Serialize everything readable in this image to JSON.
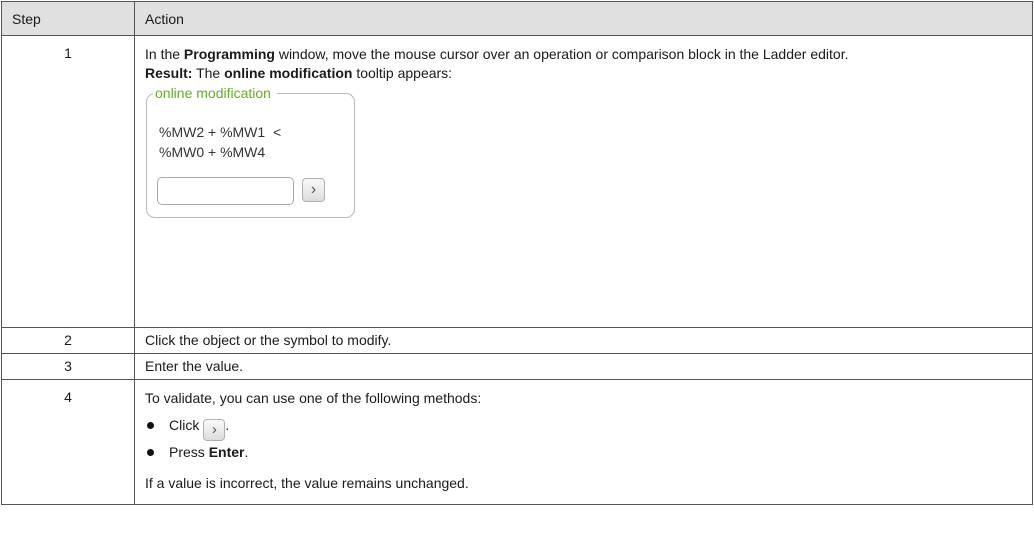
{
  "table": {
    "headers": {
      "step": "Step",
      "action": "Action"
    },
    "row1": {
      "num": "1",
      "text_pre": "In the ",
      "bold1": "Programming",
      "text_post": " window, move the mouse cursor over an operation or comparison block in the Ladder editor.",
      "result_label": "Result:",
      "result_pre": " The ",
      "result_bold": "online modification",
      "result_post": " tooltip appears:",
      "tooltip": {
        "title": "online modification",
        "expr_line1": "%MW2 + %MW1  <",
        "expr_line2": "%MW0 + %MW4",
        "button_icon": "chevron-right-icon",
        "button_glyph": "›"
      }
    },
    "row2": {
      "num": "2",
      "text": "Click the object or the symbol to modify."
    },
    "row3": {
      "num": "3",
      "text": "Enter the value."
    },
    "row4": {
      "num": "4",
      "intro": "To validate, you can use one of the following methods:",
      "method1_pre": "Click",
      "method1_post": ".",
      "method2_pre": "Press ",
      "method2_bold": "Enter",
      "method2_post": ".",
      "note": "If a value is incorrect, the value remains unchanged."
    }
  },
  "colors": {
    "header_bg": "#e0e0e0",
    "tooltip_title": "#62b026",
    "border": "#555555"
  }
}
